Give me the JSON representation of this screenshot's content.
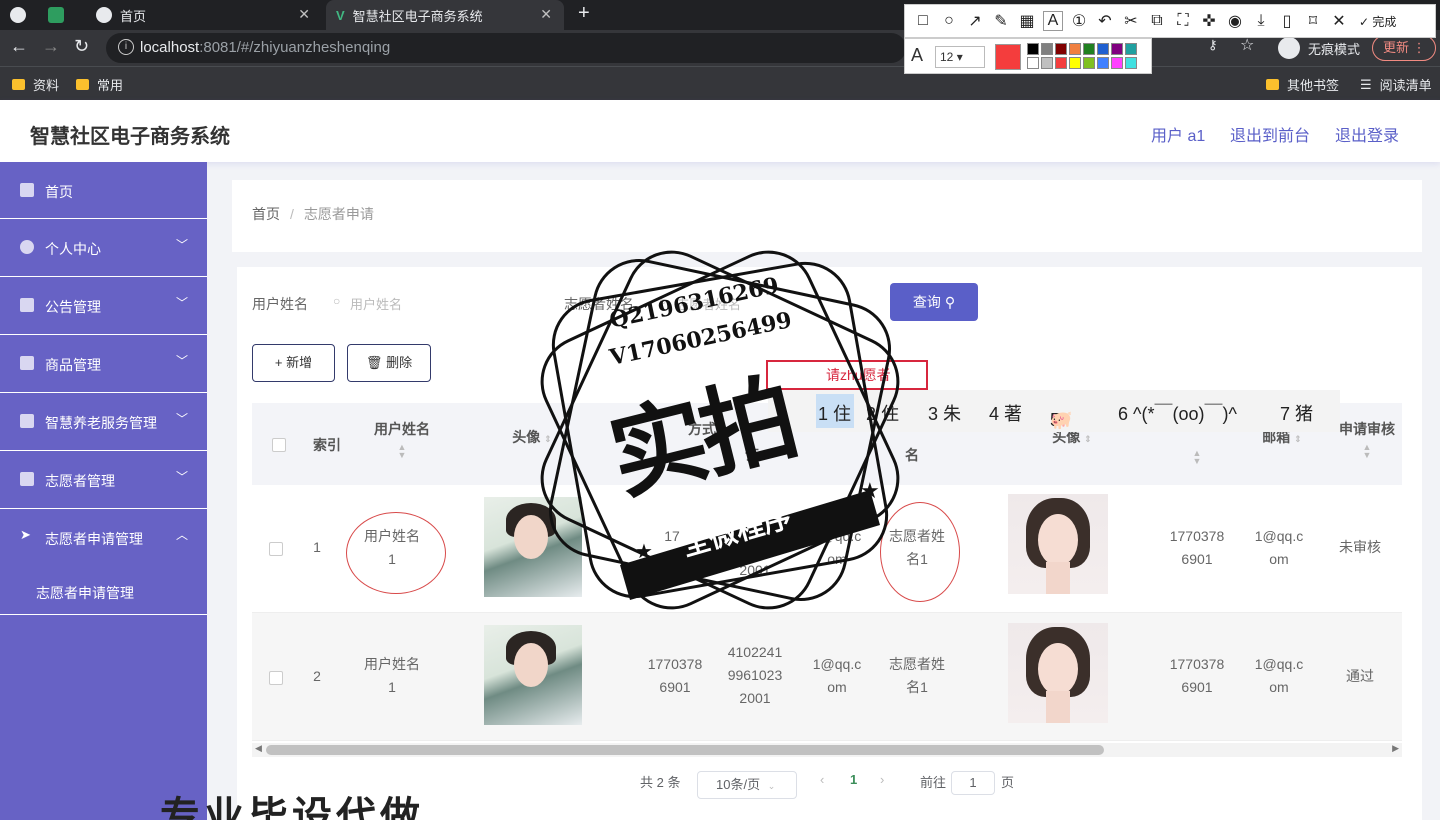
{
  "browser": {
    "tabs": [
      {
        "label": ""
      },
      {
        "label": ""
      },
      {
        "label": "首页"
      },
      {
        "label": "智慧社区电子商务系统"
      }
    ],
    "url_host": "localhost",
    "url_rest": ":8081/#/zhiyuanzheshenqing",
    "incognito_label": "无痕模式",
    "update_label": "更新",
    "bookmarks": [
      "资料",
      "常用"
    ],
    "bookmarks_right": [
      "其他书签",
      "阅读清单"
    ]
  },
  "snap_tool": {
    "done_label": "完成",
    "font_size": "12",
    "current_color": "#f43d3d",
    "palette": [
      "#000000",
      "#808080",
      "#800000",
      "#f08040",
      "#208020",
      "#2060d0",
      "#800080",
      "#20a0a0",
      "#ffffff",
      "#c0c0c0",
      "#f43d3d",
      "#ffff00",
      "#80c020",
      "#4080ff",
      "#ff40ff",
      "#40e0e0"
    ]
  },
  "header": {
    "title": "智慧社区电子商务系统",
    "user_label": "用户 a1",
    "front_label": "退出到前台",
    "logout_label": "退出登录"
  },
  "sidebar": {
    "items": [
      {
        "label": "首页"
      },
      {
        "label": "个人中心"
      },
      {
        "label": "公告管理"
      },
      {
        "label": "商品管理"
      },
      {
        "label": "智慧养老服务管理"
      },
      {
        "label": "志愿者管理"
      },
      {
        "label": "志愿者申请管理"
      }
    ],
    "sub_item": "志愿者申请管理"
  },
  "breadcrumb": {
    "home": "首页",
    "current": "志愿者申请"
  },
  "filters": {
    "user_label": "用户姓名",
    "user_placeholder": "用户姓名",
    "vol_label": "志愿者姓名",
    "vol_placeholder": "志愿者姓名",
    "query_label": "查询"
  },
  "actions": {
    "add_label": "新增",
    "delete_label": "删除"
  },
  "table": {
    "headers": {
      "index": "索引",
      "user_name": "用户姓名",
      "avatar": "头像",
      "contact": "方式",
      "id_card": "证",
      "vol_name": "名",
      "vol_avatar": "头像",
      "phone": "",
      "email": "邮箱",
      "review": "申请审核"
    },
    "rows": [
      {
        "index": "1",
        "user_name_a": "用户姓名",
        "user_name_b": "1",
        "contact_a": "17",
        "contact_b": "6901",
        "id_a": "9961023",
        "id_b": "2001",
        "email_a": "1@qq.c",
        "email_b": "om",
        "vol_a": "志愿者姓",
        "vol_b": "名1",
        "phone_a": "1770378",
        "phone_b": "6901",
        "email2_a": "1@qq.c",
        "email2_b": "om",
        "review": "未审核"
      },
      {
        "index": "2",
        "user_name_a": "用户姓名",
        "user_name_b": "1",
        "contact_a": "1770378",
        "contact_b": "6901",
        "id_top": "4102241",
        "id_a": "9961023",
        "id_b": "2001",
        "email_a": "1@qq.c",
        "email_b": "om",
        "vol_a": "志愿者姓",
        "vol_b": "名1",
        "phone_a": "1770378",
        "phone_b": "6901",
        "email2_a": "1@qq.c",
        "email2_b": "om",
        "review": "通过"
      }
    ]
  },
  "pagination": {
    "total": "共 2 条",
    "page_size": "10条/页",
    "current_page": "1",
    "goto_label": "前往",
    "goto_value": "1",
    "page_unit": "页"
  },
  "ime": {
    "composition": "请zhu愿者",
    "candidates": [
      "1 住",
      "2 住",
      "3 朱",
      "4 著",
      "5",
      "6 ^(*￣(oo)￣)^",
      "7 猪"
    ]
  },
  "watermark": {
    "line1": "Q2196316269",
    "line2": "V17060256499",
    "big": "实拍",
    "ribbon": "全微程序",
    "bottom": "专业毕设代做"
  }
}
